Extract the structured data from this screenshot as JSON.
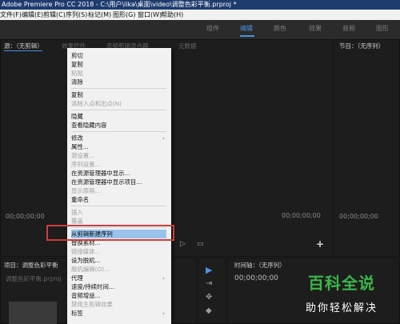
{
  "window": {
    "title": "Adobe Premiere Pro CC 2018 - C:\\用户\\lika\\桌面\\video\\调整色彩平衡.prproj *"
  },
  "menubar": [
    "文件(F)",
    "编辑(E)",
    "剪辑(C)",
    "序列(S)",
    "标记(M)",
    "图形(G)",
    "窗口(W)",
    "帮助(H)"
  ],
  "workspaces": {
    "items": [
      "组件",
      "编辑",
      "颜色",
      "效果",
      "音频",
      "图形"
    ],
    "active": "编辑"
  },
  "source_panel": {
    "tabs": [
      "源：（无剪辑）",
      "效果控件",
      "音频剪辑混合器",
      "元数据"
    ],
    "timecode": "00;00;00;00"
  },
  "program_panel": {
    "tab": "节目：（无序列）",
    "timecode_left": "00;00;00;00",
    "timecode_right": "00;00;00;00"
  },
  "project_panel": {
    "tab": "项目：调整色彩平衡",
    "path": "调整色彩平衡.prproj"
  },
  "timeline_panel": {
    "tab": "时间轴：（无序列）",
    "timecode": "00;00;00;00"
  },
  "context_menu": {
    "items": [
      {
        "label": "剪切",
        "disabled": false
      },
      {
        "label": "复制",
        "disabled": false
      },
      {
        "label": "粘贴",
        "disabled": true
      },
      {
        "label": "清除",
        "disabled": false
      },
      {
        "label": "复制",
        "disabled": false
      },
      {
        "label": "清除入点和出点(N)",
        "disabled": true
      },
      {
        "label": "隐藏",
        "disabled": false
      },
      {
        "label": "查看隐藏内容",
        "disabled": false
      },
      {
        "label": "修改",
        "disabled": false,
        "submenu": true
      },
      {
        "label": "属性...",
        "disabled": false
      },
      {
        "label": "源设置...",
        "disabled": true
      },
      {
        "label": "序列设置...",
        "disabled": true
      },
      {
        "label": "在资源管理器中显示...",
        "disabled": false
      },
      {
        "label": "在资源管理器中显示项目...",
        "disabled": false
      },
      {
        "label": "显示原格...",
        "disabled": true
      },
      {
        "label": "重命名",
        "disabled": false
      },
      {
        "label": "插入",
        "disabled": true
      },
      {
        "label": "覆盖",
        "disabled": true
      },
      {
        "label": "从剪辑新建序列",
        "disabled": false,
        "highlighted": true
      },
      {
        "label": "替换素材...",
        "disabled": false
      },
      {
        "label": "链接媒体...",
        "disabled": true
      },
      {
        "label": "设为脱机...",
        "disabled": false
      },
      {
        "label": "脱机编辑(O)...",
        "disabled": true
      },
      {
        "label": "代理",
        "disabled": false,
        "submenu": true
      },
      {
        "label": "速度/持续时间...",
        "disabled": false
      },
      {
        "label": "音频增益...",
        "disabled": false
      },
      {
        "label": "禁用主剪辑效果",
        "disabled": true
      },
      {
        "label": "标签",
        "disabled": false,
        "submenu": true
      }
    ],
    "submenu_arrow": "›"
  },
  "watermark": {
    "title": "百科全说",
    "subtitle": "助你轻松解决"
  },
  "colors": {
    "highlight": "#99c3ec",
    "red_box": "#d33b3b",
    "accent_blue": "#4a90e2",
    "watermark_green": "#3bb54a"
  }
}
